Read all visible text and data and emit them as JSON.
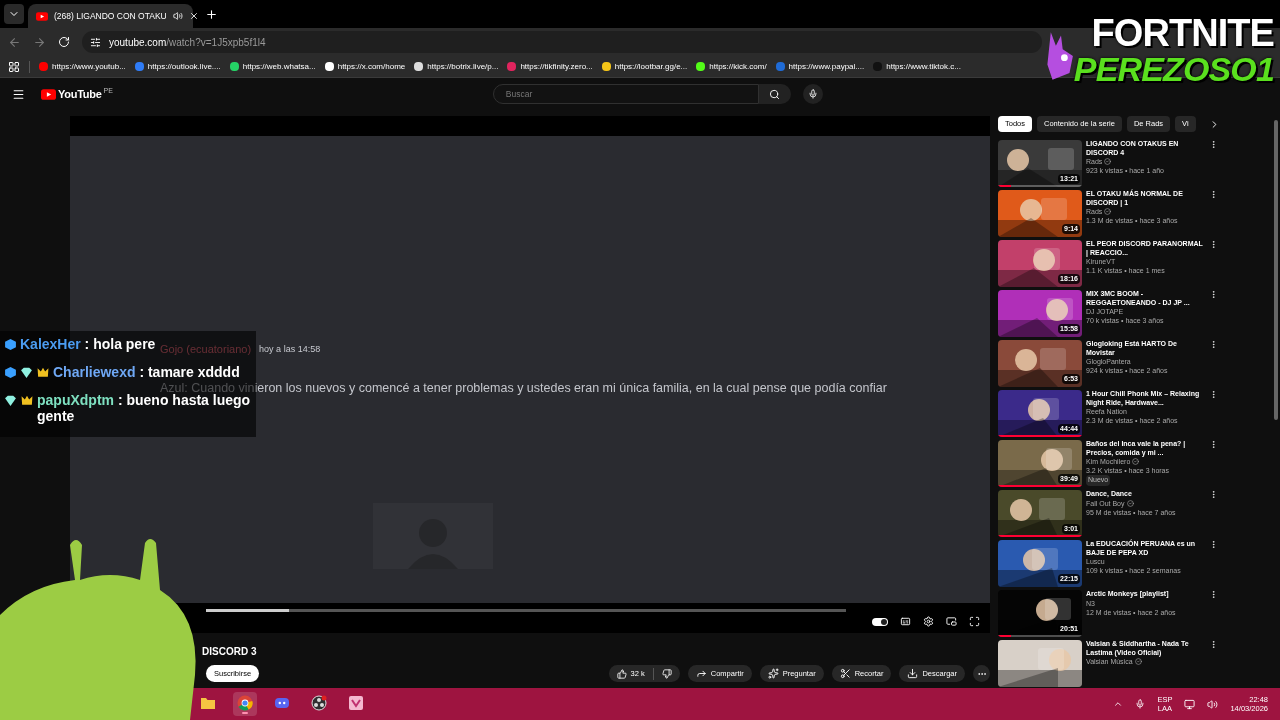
{
  "browser": {
    "tab": {
      "title": "(268) LIGANDO CON OTAKU",
      "selected": true
    },
    "url": {
      "host": "youtube.com",
      "path": "/watch?v=1J5xpb5f1l4"
    },
    "bookmarks": [
      {
        "label": "https://www.youtub...",
        "color": "#ff0000"
      },
      {
        "label": "https://outlook.live....",
        "color": "#2f7cf6"
      },
      {
        "label": "https://web.whatsa...",
        "color": "#25d366"
      },
      {
        "label": "https://x.com/home",
        "color": "#ffffff"
      },
      {
        "label": "https://botrix.live/p...",
        "color": "#dddddd"
      },
      {
        "label": "https://tikfinity.zero...",
        "color": "#e0245e"
      },
      {
        "label": "https://lootbar.gg/e...",
        "color": "#f5c518"
      },
      {
        "label": "https://kick.com/",
        "color": "#53fc18"
      },
      {
        "label": "https://www.paypal....",
        "color": "#1f6bd6"
      },
      {
        "label": "https://www.tiktok.c...",
        "color": "#111111"
      }
    ]
  },
  "youtube": {
    "logo": "YouTube",
    "region": "PE",
    "search": {
      "placeholder": "Buscar"
    }
  },
  "player": {
    "level": 0.13,
    "autoplay": true,
    "discord": {
      "author": "Gojo (ecuatoriano)",
      "time": "hoy a las 14:58",
      "message": "Azul: Cuando vinieron los nuevos y comencé a tener problemas y ustedes eran mi única familia, en la cual pense que podía confiar"
    }
  },
  "video": {
    "title": "DISCORD 3",
    "subscribe": "Suscribirse",
    "likes": "32 k",
    "actions": [
      {
        "label": "Compartir",
        "kind": "share"
      },
      {
        "label": "Preguntar",
        "kind": "ask"
      },
      {
        "label": "Recortar",
        "kind": "clip"
      },
      {
        "label": "Descargar",
        "kind": "download"
      }
    ]
  },
  "chips": [
    {
      "label": "Todos",
      "selected": true
    },
    {
      "label": "Contenido de la serie",
      "selected": false
    },
    {
      "label": "De Rads",
      "selected": false
    },
    {
      "label": "Vi",
      "selected": false
    }
  ],
  "recommendations": [
    {
      "title": "LIGANDO CON OTAKUS EN DISCORD 4",
      "channel": "Rads",
      "verified": true,
      "meta": "923 k vistas • hace 1 año",
      "duration": "13:21",
      "level": 0.15
    },
    {
      "title": "EL OTAKU MÁS NORMAL DE DISCORD | 1",
      "channel": "Rads",
      "verified": true,
      "meta": "1.3 M de vistas • hace 3 años",
      "duration": "9:14"
    },
    {
      "title": "EL PEOR DISCORD PARANORMAL | REACCIO...",
      "channel": "KiruneVT",
      "verified": false,
      "meta": "1.1 K vistas • hace 1 mes",
      "duration": "18:16"
    },
    {
      "title": "MIX 3MC BOOM - REGGAETONEANDO - DJ JP ...",
      "channel": "DJ JOTAPE",
      "verified": false,
      "meta": "70 k vistas • hace 3 años",
      "duration": "15:58"
    },
    {
      "title": "Glogloking Está HARTO De Movistar",
      "channel": "GlogloPantera",
      "verified": false,
      "meta": "924 k vistas • hace 2 años",
      "duration": "6:53"
    },
    {
      "title": "1 Hour Chill Phonk Mix – Relaxing Night Ride, Hardwave...",
      "channel": "Reefa Nation",
      "verified": false,
      "meta": "2.3 M de vistas • hace 2 años",
      "duration": "44:44",
      "level": 1
    },
    {
      "title": "Baños del Inca vale la pena? | Precios, comida y mi ...",
      "channel": "Kim Mochilero",
      "verified": true,
      "meta": "3.2 K vistas • hace 3 horas",
      "badge": "Nuevo",
      "duration": "39:49",
      "level": 1
    },
    {
      "title": "Dance, Dance",
      "channel": "Fall Out Boy",
      "verified": true,
      "meta": "95 M de vistas • hace 7 años",
      "duration": "3:01",
      "level": 1
    },
    {
      "title": "La EDUCACIÓN PERUANA es un BAJE DE PEPA XD",
      "channel": "Luscu",
      "verified": false,
      "meta": "109 k vistas • hace 2 semanas",
      "duration": "22:15"
    },
    {
      "title": "Arctic Monkeys [playlist]",
      "channel": "N3",
      "verified": false,
      "meta": "12 M de vistas • hace 2 años",
      "duration": "20:51",
      "level": 0.15
    },
    {
      "title": "Valsian & Siddhartha - Nada Te Lastima (Video Oficial)",
      "channel": "Valsian Música",
      "verified": true
    }
  ],
  "chat": [
    {
      "user": "KalexHer",
      "color": "#4b9cf0",
      "badges": [
        {
          "kind": "cube"
        }
      ],
      "text": ": hola pere"
    },
    {
      "user": "Charliewexd",
      "color": "#6fa8f5",
      "badges": [
        {
          "kind": "cube"
        },
        {
          "kind": "diamond"
        },
        {
          "kind": "crown"
        }
      ],
      "text": ": tamare xdddd"
    },
    {
      "user": "papuXdptm",
      "color": "#7ee0c0",
      "badges": [
        {
          "kind": "diamond"
        },
        {
          "kind": "crown"
        }
      ],
      "text": ": bueno hasta luego gente"
    }
  ],
  "overlay_logo": {
    "line_1": "FORTNITE",
    "line_2": "PEREZOSO1"
  },
  "taskbar": {
    "apps": [
      {
        "kind": "files",
        "active": false
      },
      {
        "kind": "chrome",
        "active": true
      },
      {
        "kind": "discord",
        "active": false
      },
      {
        "kind": "obs",
        "active": false
      },
      {
        "kind": "pink",
        "active": false
      }
    ],
    "language": "ESP",
    "layout": "LAA",
    "time": "22:48",
    "date": "14/03/2026"
  }
}
